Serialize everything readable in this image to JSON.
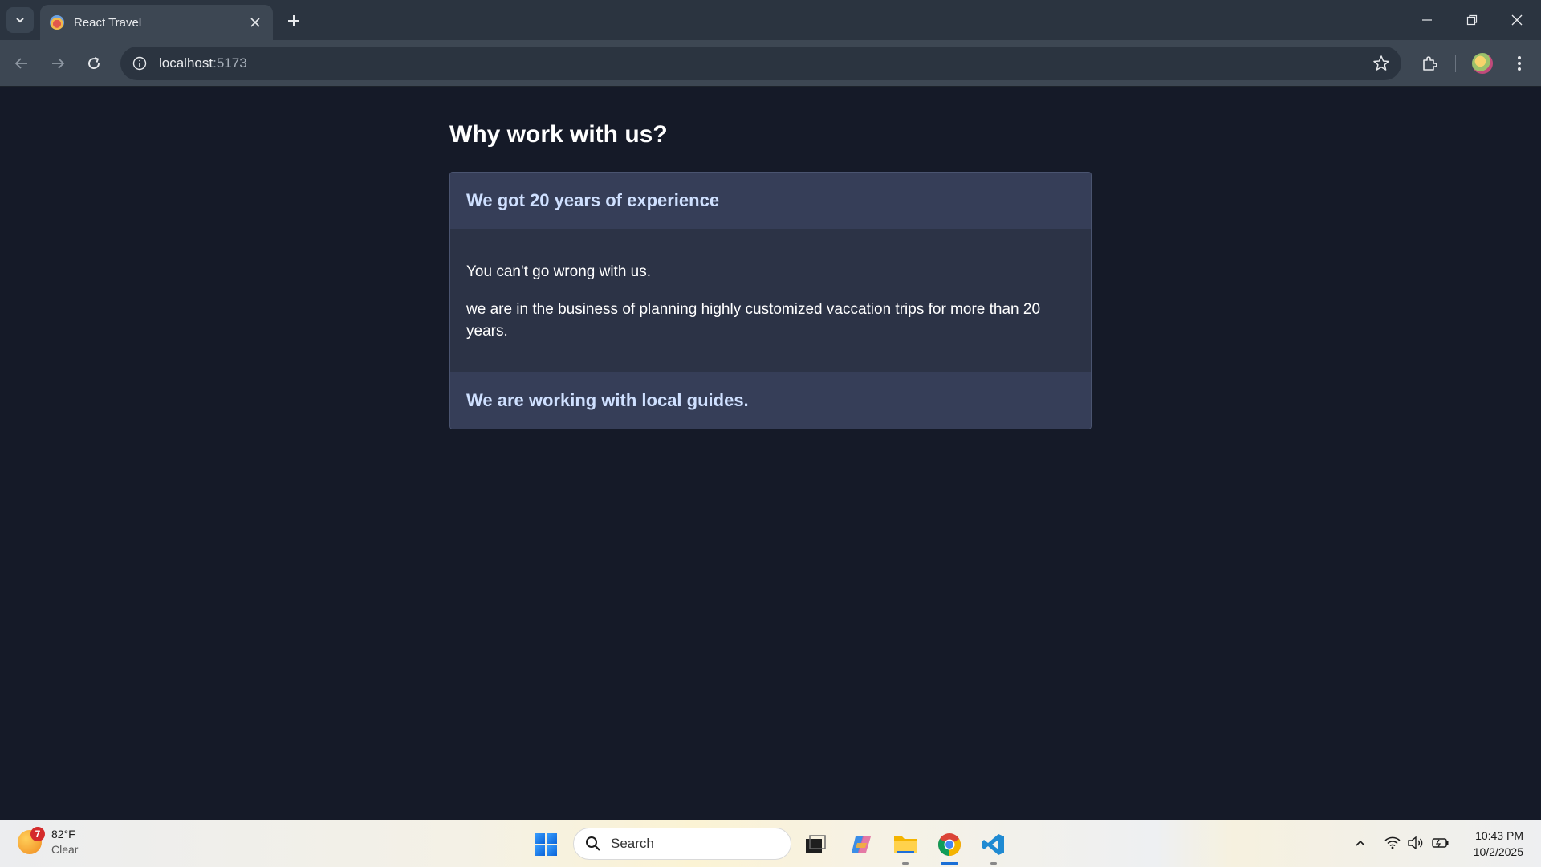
{
  "browser": {
    "tab_title": "React Travel",
    "url_host": "localhost",
    "url_port": ":5173"
  },
  "page": {
    "heading": "Why work with us?",
    "accordion": [
      {
        "title": "We got 20 years of experience",
        "expanded": true,
        "paragraphs": [
          "You can't go wrong with us.",
          "we are in the business of planning highly customized vaccation trips for more than 20 years."
        ]
      },
      {
        "title": "We are working with local guides.",
        "expanded": false
      }
    ]
  },
  "taskbar": {
    "weather_badge": "7",
    "weather_temp": "82°F",
    "weather_condition": "Clear",
    "search_label": "Search",
    "time": "10:43 PM",
    "date": "10/2/2025"
  },
  "colors": {
    "page_background": "#151a28",
    "accordion_header": "#363e58",
    "accordion_header_text": "#cfe0ff",
    "accordion_body": "#2c3346"
  },
  "icons": [
    "tab-search-icon",
    "close-icon",
    "plus-icon",
    "minimize-icon",
    "restore-icon",
    "back-icon",
    "forward-icon",
    "reload-icon",
    "info-icon",
    "star-icon",
    "extensions-icon",
    "more-icon",
    "windows-icon",
    "search-icon",
    "task-view-icon",
    "copilot-icon",
    "file-explorer-icon",
    "chrome-icon",
    "vscode-icon",
    "chevron-up-icon",
    "wifi-icon",
    "volume-icon",
    "battery-icon"
  ]
}
